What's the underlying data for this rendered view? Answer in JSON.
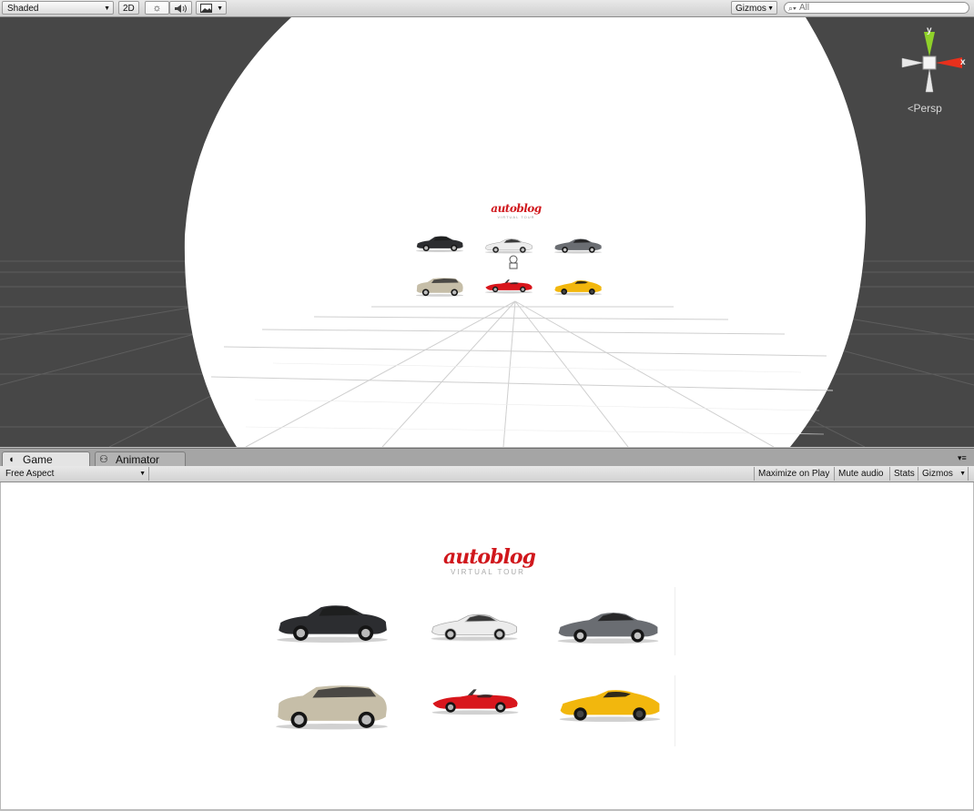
{
  "scene_toolbar": {
    "draw_mode": "Shaded",
    "mode_2d": "2D",
    "gizmos": "Gizmos",
    "search_placeholder": "All"
  },
  "scene_view": {
    "gizmo_axes": {
      "y": "y",
      "x": "x"
    },
    "projection": "Persp",
    "logo": {
      "brand": "autoblog",
      "tagline": "VIRTUAL TOUR"
    }
  },
  "game_panel": {
    "tabs": [
      {
        "label": "Game",
        "icon": "pacman-icon",
        "active": true
      },
      {
        "label": "Animator",
        "icon": "animator-icon",
        "active": false
      }
    ],
    "aspect": "Free Aspect",
    "buttons": {
      "maximize": "Maximize on Play",
      "mute": "Mute audio",
      "stats": "Stats",
      "gizmos": "Gizmos"
    },
    "logo": {
      "brand": "autoblog",
      "tagline": "VIRTUAL TOUR"
    }
  },
  "cars": [
    {
      "name": "black-sedan",
      "color": "#2c2d30"
    },
    {
      "name": "white-coupe",
      "color": "#ececec"
    },
    {
      "name": "gray-coupe",
      "color": "#6a6d72"
    },
    {
      "name": "silver-suv",
      "color": "#c6bea8"
    },
    {
      "name": "red-convertible",
      "color": "#d8161c"
    },
    {
      "name": "yellow-supercar",
      "color": "#f2b70d"
    }
  ],
  "colors": {
    "editor_gray": "#474747",
    "logo_red": "#d0171c",
    "gizmo_x": "#e8301c",
    "gizmo_y": "#8fd12a"
  }
}
